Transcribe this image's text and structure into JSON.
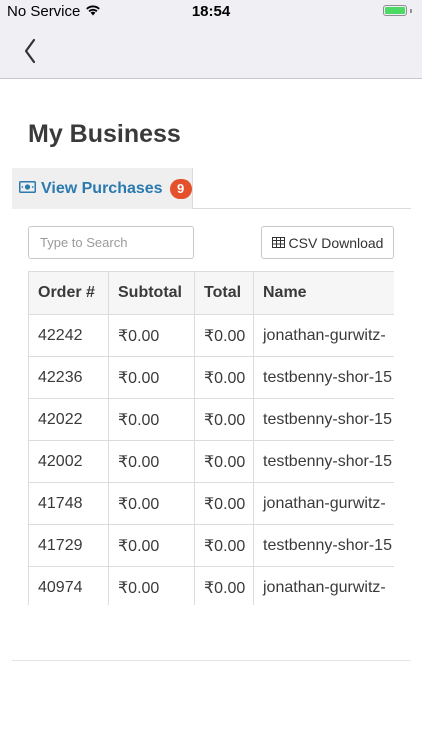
{
  "status_bar": {
    "carrier": "No Service",
    "time": "18:54"
  },
  "nav": {
    "back_icon": "chevron-left-icon"
  },
  "page": {
    "title": "My Business"
  },
  "tab": {
    "label": "View Purchases",
    "badge": "9",
    "icon": "cash-icon"
  },
  "toolbar": {
    "search_placeholder": "Type to Search",
    "search_value": "",
    "csv_label": "CSV Download",
    "csv_icon": "table-icon"
  },
  "table": {
    "headers": [
      "Order #",
      "Subtotal",
      "Total",
      "Name"
    ],
    "rows": [
      [
        "42242",
        "₹0.00",
        "₹0.00",
        "jonathan-gurwitz-"
      ],
      [
        "42236",
        "₹0.00",
        "₹0.00",
        "testbenny-shor-15"
      ],
      [
        "42022",
        "₹0.00",
        "₹0.00",
        "testbenny-shor-15"
      ],
      [
        "42002",
        "₹0.00",
        "₹0.00",
        "testbenny-shor-15"
      ],
      [
        "41748",
        "₹0.00",
        "₹0.00",
        "jonathan-gurwitz-"
      ],
      [
        "41729",
        "₹0.00",
        "₹0.00",
        "testbenny-shor-15"
      ],
      [
        "40974",
        "₹0.00",
        "₹0.00",
        "jonathan-gurwitz-"
      ]
    ]
  },
  "colors": {
    "accent": "#2a7ab0",
    "badge": "#e4502a",
    "battery": "#4cd964"
  }
}
